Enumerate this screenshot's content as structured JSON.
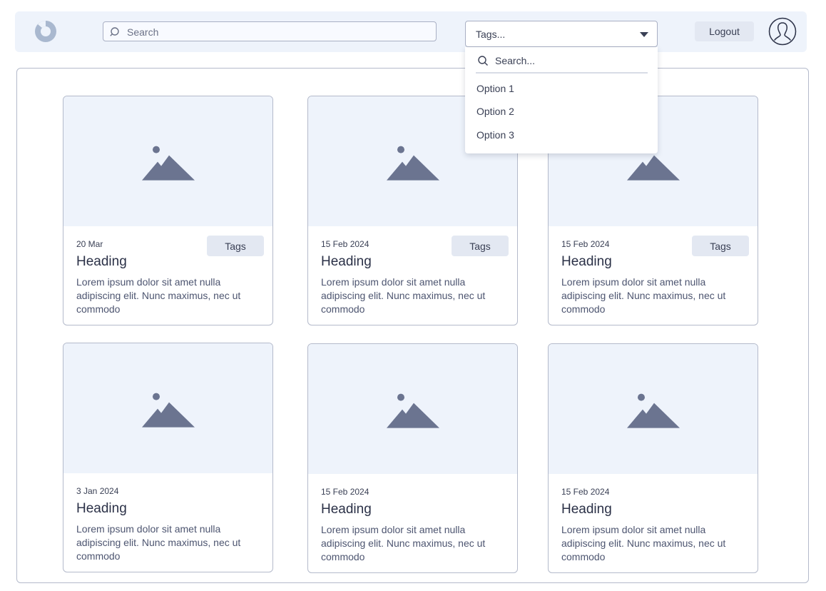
{
  "header": {
    "search_placeholder": "Search",
    "tags_select_value": "Tags...",
    "logout_label": "Logout"
  },
  "dropdown": {
    "search_placeholder": "Search...",
    "options": [
      "Option 1",
      "Option 2",
      "Option 3"
    ]
  },
  "cards": [
    {
      "date": "20 Mar",
      "tag": "Tags",
      "heading": "Heading",
      "body": "Lorem ipsum dolor sit amet nulla adipiscing elit. Nunc maximus, nec ut commodo"
    },
    {
      "date": "15 Feb 2024",
      "tag": "Tags",
      "heading": "Heading",
      "body": "Lorem ipsum dolor sit amet nulla adipiscing elit. Nunc maximus, nec ut commodo"
    },
    {
      "date": "15 Feb 2024",
      "tag": "Tags",
      "heading": "Heading",
      "body": "Lorem ipsum dolor sit amet nulla adipiscing elit. Nunc maximus, nec ut commodo"
    },
    {
      "date": "3 Jan 2024",
      "heading": "Heading",
      "body": "Lorem ipsum dolor sit amet nulla adipiscing elit. Nunc maximus, nec ut commodo"
    },
    {
      "date": "15 Feb 2024",
      "heading": "Heading",
      "body": "Lorem ipsum dolor sit amet nulla adipiscing elit. Nunc maximus, nec ut commodo"
    },
    {
      "date": "15 Feb 2024",
      "heading": "Heading",
      "body": "Lorem ipsum dolor sit amet nulla adipiscing elit. Nunc maximus, nec ut commodo"
    }
  ],
  "icons": {
    "logo": "logo-icon",
    "search": "search-icon",
    "caret": "chevron-down-icon",
    "avatar": "user-avatar-icon",
    "image_placeholder": "image-placeholder-icon"
  },
  "colors": {
    "background_panel": "#eef3fb",
    "icon": "#6b7490",
    "border": "#b4bacb",
    "tag_bg": "#e3e8f2"
  }
}
